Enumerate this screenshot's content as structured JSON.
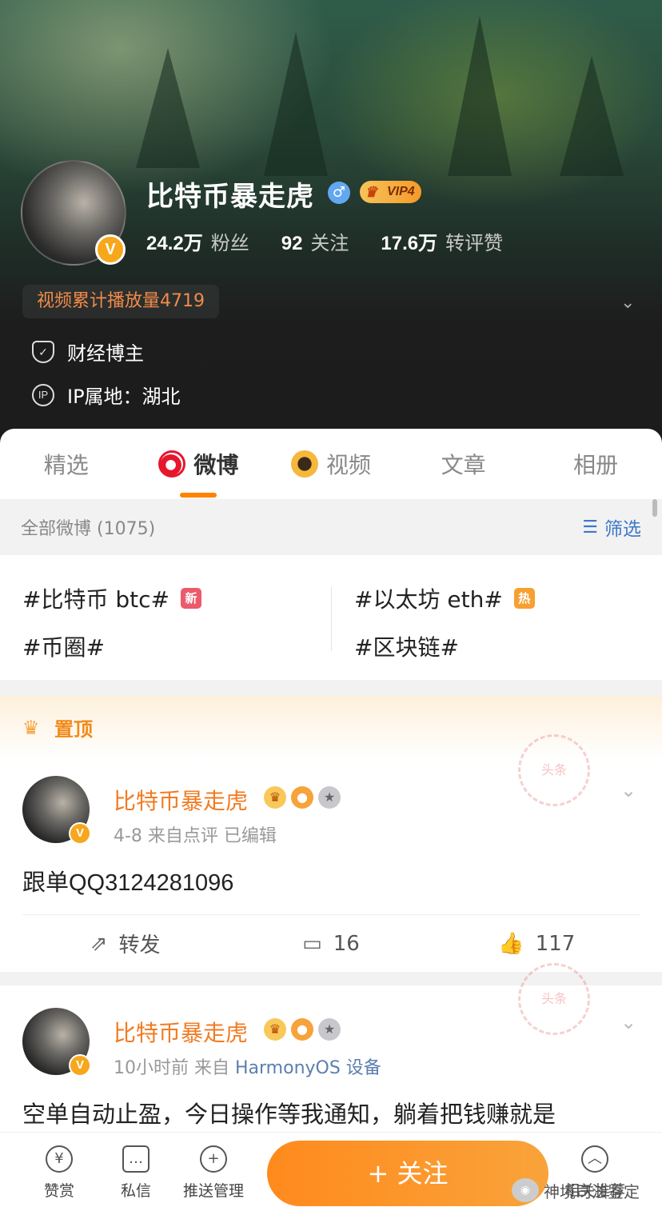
{
  "profile": {
    "name": "比特币暴走虎",
    "gender_symbol": "♂",
    "vip_label": "VIP4",
    "vbadge": "V",
    "stats": [
      {
        "value": "24.2万",
        "label": "粉丝"
      },
      {
        "value": "92",
        "label": "关注"
      },
      {
        "value": "17.6万",
        "label": "转评赞"
      }
    ],
    "video_plays": "视频累计播放量4719",
    "category": "财经博主",
    "ip_location": "IP属地：湖北",
    "ip_icon_text": "IP"
  },
  "tabs": [
    {
      "label": "精选"
    },
    {
      "label": "微博"
    },
    {
      "label": "视频"
    },
    {
      "label": "文章"
    },
    {
      "label": "相册"
    }
  ],
  "filter": {
    "all_label": "全部微博 (1075)",
    "filter_label": "筛选"
  },
  "topics": [
    {
      "text": "#比特币 btc#",
      "tag": "新"
    },
    {
      "text": "#以太坊 eth#",
      "tag": "热"
    },
    {
      "text": "#币圈#"
    },
    {
      "text": "#区块链#"
    }
  ],
  "pinned_label": "置顶",
  "stamp_text": "头条",
  "posts": [
    {
      "author": "比特币暴走虎",
      "meta": "4-8  来自点评  已编辑",
      "text": "跟单QQ3124281096",
      "repost_label": "转发",
      "comments": "16",
      "likes": "117"
    },
    {
      "author": "比特币暴走虎",
      "meta_time": "10小时前  来自",
      "meta_source": "HarmonyOS 设备",
      "text": "空单自动止盈，今日操作等我通知，躺着把钱赚就是"
    }
  ],
  "bottom_bar": {
    "reward": "赞赏",
    "message": "私信",
    "push": "推送管理",
    "follow": "+ 关注",
    "recommend": "相关推荐"
  },
  "watermark": "神境司法鉴定"
}
